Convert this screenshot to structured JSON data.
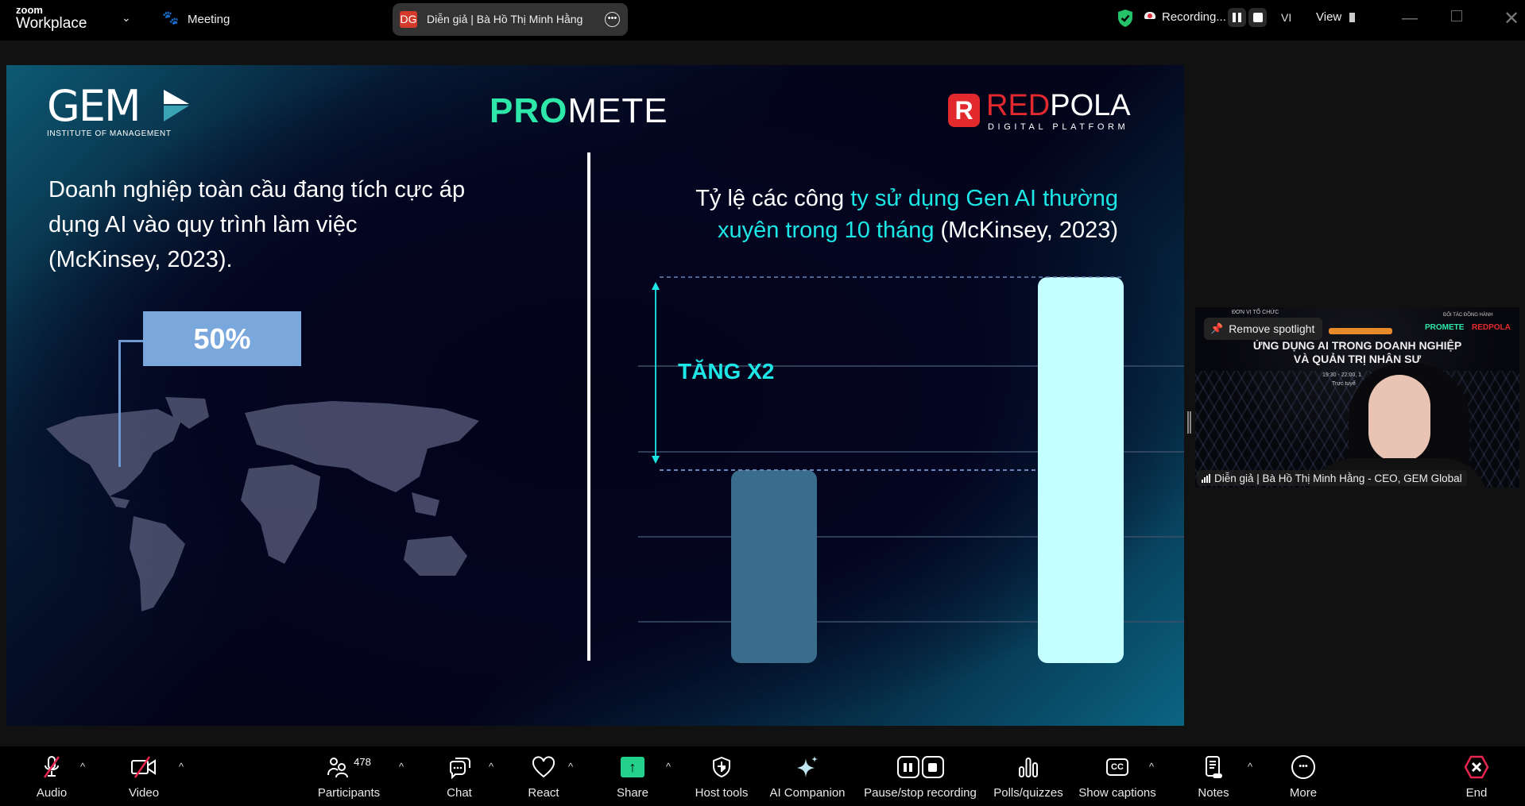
{
  "app": {
    "brand_top": "zoom",
    "brand_bottom": "Workplace",
    "meeting_label": "Meeting"
  },
  "speaker_pill": {
    "initials": "DG",
    "name": "Diễn giả | Bà Hồ Thị Minh Hằng"
  },
  "recording": {
    "label": "Recording...",
    "language": "VI",
    "view_label": "View"
  },
  "slide": {
    "logos": {
      "gem": "GEM",
      "gem_sub": "INSTITUTE OF MANAGEMENT",
      "promete_a": "PRO",
      "promete_b": "METE",
      "redpola_a": "RED",
      "redpola_b": "POLA",
      "redpola_sub": "DIGITAL PLATFORM"
    },
    "left_text": [
      "Doanh nghiệp toàn cầu đang tích cực áp",
      "dụng AI vào quy trình làm việc",
      "(McKinsey, 2023)."
    ],
    "stat": "50%",
    "right_title": {
      "line1_white": "Tỷ lệ các công ",
      "line1_cyan": "ty sử dụng Gen AI thường",
      "line2_cyan": "xuyên trong 10 tháng",
      "line2_white": " (McKinsey, 2023)"
    },
    "annotation": "TĂNG X2"
  },
  "chart_data": {
    "type": "bar",
    "values": [
      1,
      2
    ],
    "colors": [
      "#3a6c8c",
      "#c4feff"
    ],
    "annotation": "TĂNG X2",
    "grid": true
  },
  "video_tile": {
    "spotlight": "Remove spotlight",
    "name_label": "Diễn giả | Bà Hồ Thị Minh Hằng - CEO, GEM Global",
    "bg_texts": {
      "organizer": "ĐƠN VỊ TỔ CHỨC",
      "partner": "ĐỐI TÁC ĐỒNG HÀNH",
      "title1": "ỨNG DỤNG AI TRONG DOANH NGHIỆP",
      "title2": "VÀ QUẢN TRỊ NHÂN SỰ",
      "time": "19:30 - 22:00, 1",
      "mode": "Trực tuyế",
      "promete": "PROMETE",
      "redpola": "REDPOLA"
    }
  },
  "toolbar": {
    "audio": "Audio",
    "video": "Video",
    "participants": "Participants",
    "participants_count": "478",
    "chat": "Chat",
    "react": "React",
    "share": "Share",
    "host_tools": "Host tools",
    "ai_companion": "AI Companion",
    "pause_stop": "Pause/stop recording",
    "polls": "Polls/quizzes",
    "captions": "Show captions",
    "notes": "Notes",
    "more": "More",
    "end": "End"
  },
  "colors": {
    "share_green": "#23d18b",
    "end_red": "#e8254f",
    "cyan": "#1de6e6",
    "shield_green": "#25c26a"
  }
}
